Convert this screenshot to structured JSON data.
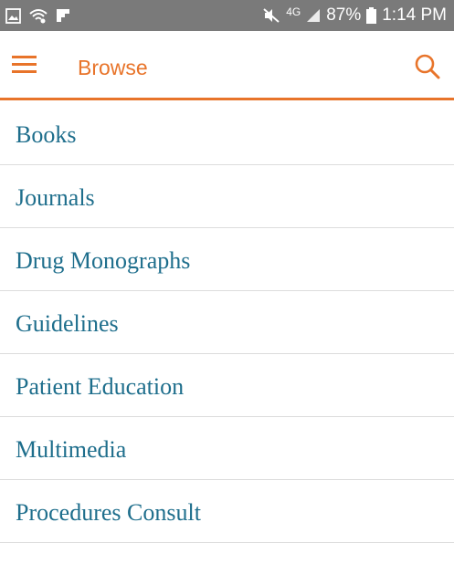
{
  "status_bar": {
    "network_label": "4G",
    "battery_percent": "87%",
    "time": "1:14 PM",
    "icons": [
      "image-icon",
      "wifi-icon",
      "flipboard-icon",
      "mute-icon",
      "signal-icon",
      "battery-icon"
    ]
  },
  "app_bar": {
    "title": "Browse",
    "menu_icon": "hamburger-menu-icon",
    "search_icon": "search-icon",
    "accent_color": "#e8742a"
  },
  "browse_items": [
    {
      "label": "Books"
    },
    {
      "label": "Journals"
    },
    {
      "label": "Drug Monographs"
    },
    {
      "label": "Guidelines"
    },
    {
      "label": "Patient Education"
    },
    {
      "label": "Multimedia"
    },
    {
      "label": "Procedures Consult"
    }
  ],
  "colors": {
    "status_bar_bg": "#7a7a7a",
    "list_text": "#1e6e8c",
    "divider": "#dcdcdc"
  }
}
